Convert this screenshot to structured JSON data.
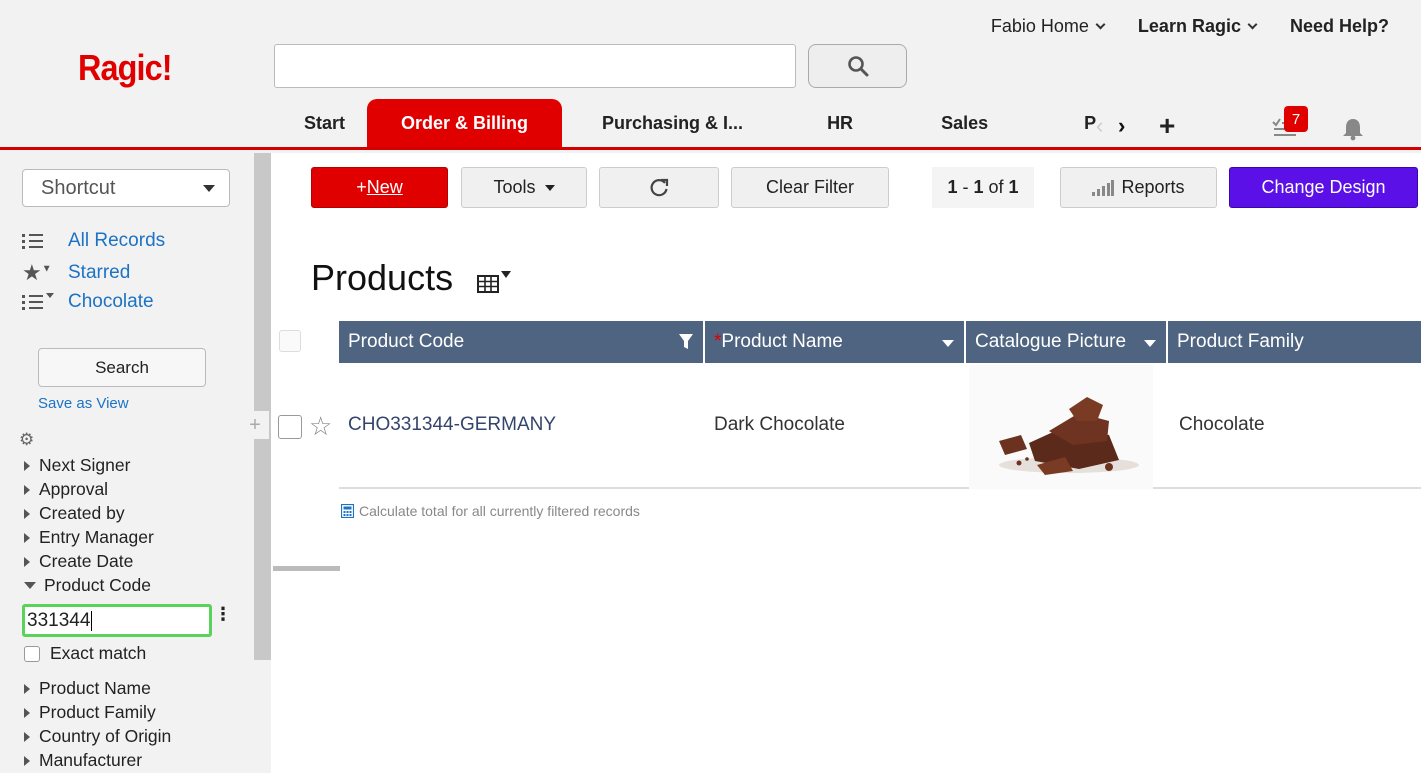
{
  "brand": {
    "logo": "Ragic!",
    "accent": "#e00000",
    "design_color": "#5a10e6",
    "header_blue": "#4f6480"
  },
  "top_nav": {
    "account": "Fabio Home",
    "learn": "Learn Ragic",
    "help": "Need Help?"
  },
  "search": {
    "placeholder": "",
    "button_icon": "search-icon"
  },
  "tabs": [
    {
      "label": "Start"
    },
    {
      "label": "Order & Billing",
      "active": true
    },
    {
      "label": "Purchasing & I..."
    },
    {
      "label": "HR"
    },
    {
      "label": "Sales"
    },
    {
      "label": "P"
    }
  ],
  "tab_controls": {
    "add": "+",
    "notifications_count": "7"
  },
  "sidebar": {
    "shortcut": "Shortcut",
    "views": [
      {
        "label": "All Records",
        "icon": "list-icon"
      },
      {
        "label": "Starred",
        "icon": "star-filter-icon"
      },
      {
        "label": "Chocolate",
        "icon": "list-filter-icon"
      }
    ],
    "search_button": "Search",
    "save_view": "Save as View",
    "filters_before": [
      "Next Signer",
      "Approval",
      "Created by",
      "Entry Manager",
      "Create Date"
    ],
    "expanded_filter": "Product Code",
    "filter_value": "331344",
    "exact_match": "Exact match",
    "filters_after": [
      "Product Name",
      "Product Family",
      "Country of Origin",
      "Manufacturer"
    ]
  },
  "toolbar": {
    "new_prefix": "+",
    "new_label": "New",
    "tools": "Tools",
    "clear_filter": "Clear Filter",
    "pager_from": "1",
    "pager_sep": " - ",
    "pager_to": "1",
    "pager_of": " of ",
    "pager_total": "1",
    "reports": "Reports",
    "change_design": "Change Design"
  },
  "sheet": {
    "title": "Products",
    "columns": [
      {
        "label": "Product Code",
        "required": false
      },
      {
        "label": "Product Name",
        "required": true
      },
      {
        "label": "Catalogue Picture",
        "required": false
      },
      {
        "label": "Product Family",
        "required": false
      }
    ],
    "rows": [
      {
        "code": "CHO331344-GERMANY",
        "name": "Dark Chocolate",
        "family": "Chocolate"
      }
    ],
    "calc_text": "Calculate total for all currently filtered records"
  }
}
